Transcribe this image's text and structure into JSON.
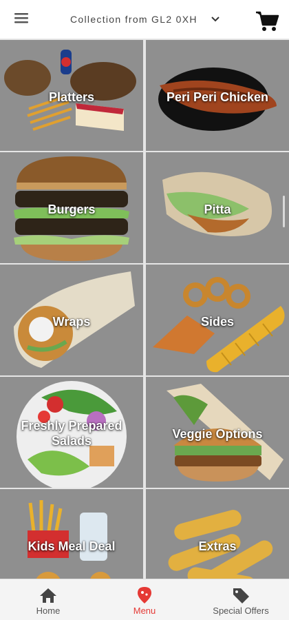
{
  "header": {
    "location_text": "Collection from GL2 0XH",
    "menu_icon": "hamburger-icon",
    "cart_icon": "cart-icon"
  },
  "categories": [
    {
      "label": "Platters"
    },
    {
      "label": "Peri Peri Chicken"
    },
    {
      "label": "Burgers"
    },
    {
      "label": "Pitta"
    },
    {
      "label": "Wraps"
    },
    {
      "label": "Sides"
    },
    {
      "label_line1": "Freshly Prepared",
      "label_line2": "Salads"
    },
    {
      "label": "Veggie Options"
    },
    {
      "label": "Kids Meal Deal"
    },
    {
      "label": "Extras"
    }
  ],
  "bottom_nav": {
    "items": [
      {
        "label": "Home",
        "icon": "home-icon"
      },
      {
        "label": "Menu",
        "icon": "location-pin-icon",
        "active": true
      },
      {
        "label": "Special Offers",
        "icon": "tag-icon"
      }
    ],
    "active_color": "#e53935",
    "inactive_color": "#555555"
  }
}
